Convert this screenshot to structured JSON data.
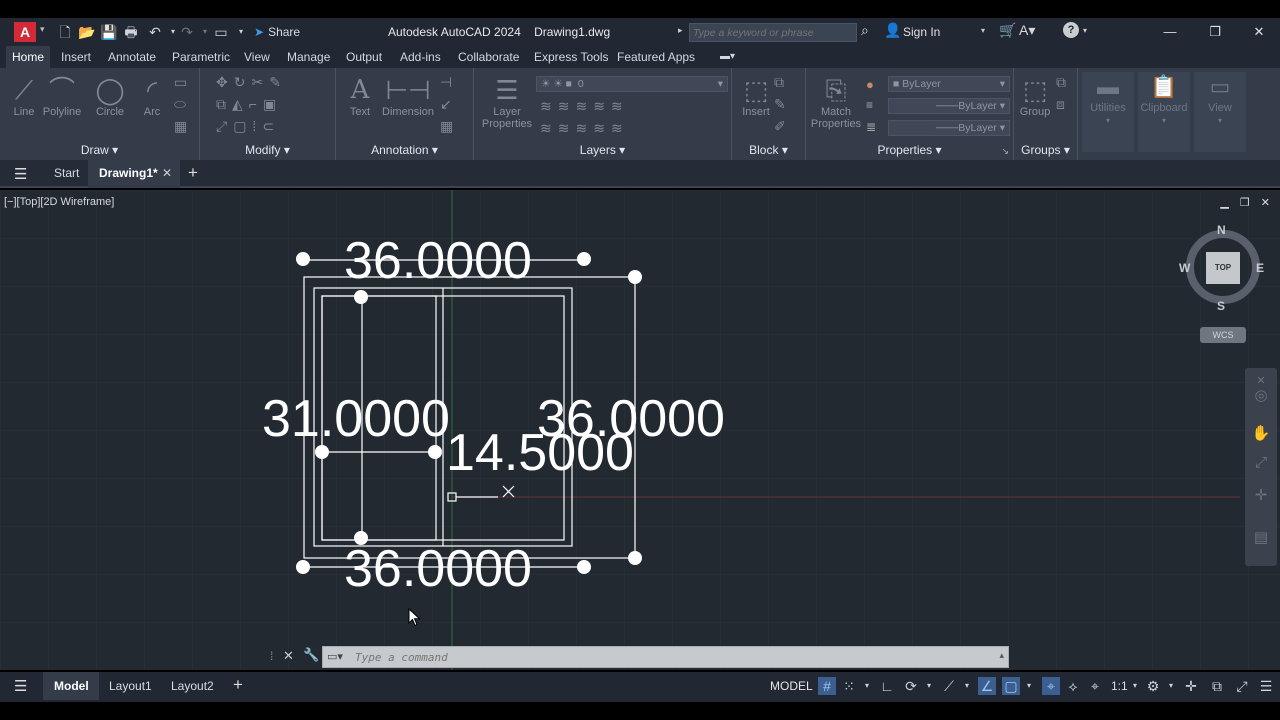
{
  "app": {
    "logo_letter": "A",
    "title": "Autodesk AutoCAD 2024",
    "filename": "Drawing1.dwg",
    "share_label": "Share",
    "search_placeholder": "Type a keyword or phrase",
    "signin_label": "Sign In"
  },
  "ribbon_tabs": [
    {
      "label": "Home",
      "active": true
    },
    {
      "label": "Insert"
    },
    {
      "label": "Annotate"
    },
    {
      "label": "Parametric"
    },
    {
      "label": "View"
    },
    {
      "label": "Manage"
    },
    {
      "label": "Output"
    },
    {
      "label": "Add-ins"
    },
    {
      "label": "Collaborate"
    },
    {
      "label": "Express Tools"
    },
    {
      "label": "Featured Apps"
    }
  ],
  "panels": {
    "draw": {
      "title": "Draw",
      "tools": [
        "Line",
        "Polyline",
        "Circle",
        "Arc"
      ]
    },
    "modify": {
      "title": "Modify"
    },
    "annotation": {
      "title": "Annotation",
      "tools": [
        "Text",
        "Dimension"
      ]
    },
    "layers": {
      "title": "Layers",
      "tools": [
        "Layer Properties"
      ],
      "layer_value": "0"
    },
    "block": {
      "title": "Block",
      "tools": [
        "Insert"
      ]
    },
    "properties": {
      "title": "Properties",
      "tools": [
        "Match Properties"
      ],
      "color": "ByLayer",
      "linetype": "ByLayer",
      "lineweight": "ByLayer"
    },
    "groups": {
      "title": "Groups",
      "tools": [
        "Group"
      ]
    },
    "utilities": {
      "title": "Utilities"
    },
    "clipboard": {
      "title": "Clipboard"
    },
    "view": {
      "title": "View"
    }
  },
  "doc_tabs": {
    "start": "Start",
    "drawing": "Drawing1*"
  },
  "viewport": {
    "label": "[−][Top][2D Wireframe]"
  },
  "drawing": {
    "dim_top": "36.0000",
    "dim_bottom": "36.0000",
    "dim_left": "31.0000",
    "dim_right": "36.0000",
    "dim_inner": "14.5000"
  },
  "viewcube": {
    "n": "N",
    "s": "S",
    "e": "E",
    "w": "W",
    "top": "TOP",
    "wcs": "WCS"
  },
  "command": {
    "placeholder": "Type a command"
  },
  "status": {
    "layouts": [
      {
        "label": "Model",
        "active": true
      },
      {
        "label": "Layout1"
      },
      {
        "label": "Layout2"
      }
    ],
    "model_label": "MODEL",
    "scale": "1:1"
  },
  "colors": {
    "canvas_bg": "#222931",
    "ribbon_bg": "#343c4a",
    "titlebar_bg": "#212833",
    "geometry": "#ffffff",
    "logo": "#d42a37"
  }
}
